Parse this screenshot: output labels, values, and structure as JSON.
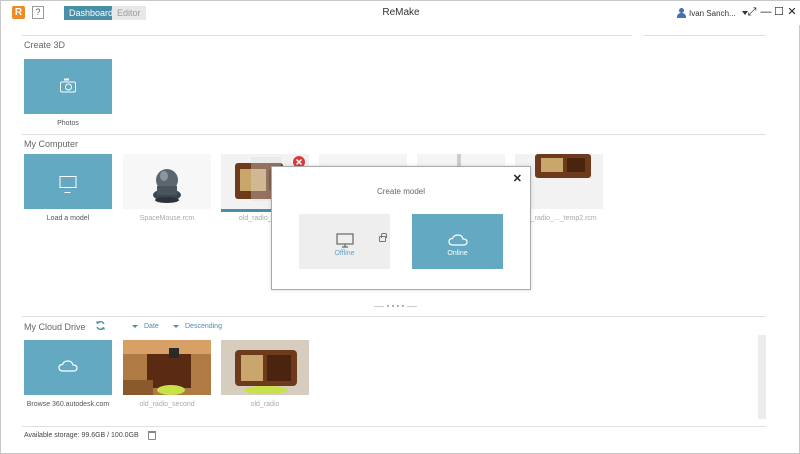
{
  "titlebar": {
    "title": "ReMake",
    "logo_letter": "R",
    "help_label": "?",
    "tabs": [
      {
        "label": "Dashboard",
        "active": true
      },
      {
        "label": "Editor",
        "active": false
      }
    ],
    "user_name": "Ivan Sanch...",
    "controls": {
      "expand": "⤢",
      "minimize": "—",
      "maximize": "☐",
      "close": "✕"
    }
  },
  "create3d": {
    "title": "Create 3D",
    "tiles": [
      {
        "label": "Photos",
        "icon": "camera-icon"
      }
    ]
  },
  "my_computer": {
    "title": "My Computer",
    "load_label": "Load a model",
    "items": [
      {
        "label": "SpaceMouse.rcm"
      },
      {
        "label": "old_radio_..._2..."
      },
      {
        "label": ""
      },
      {
        "label": ""
      },
      {
        "label": "old_radio_..._temp2.rcm"
      }
    ]
  },
  "modal": {
    "title": "Create model",
    "close": "✕",
    "offline_label": "Offline",
    "online_label": "Online"
  },
  "cloud": {
    "title": "My Cloud Drive",
    "sort_field": "Date",
    "sort_order": "Descending",
    "browse_label": "Browse 360.autodesk.com",
    "items": [
      {
        "label": "old_radio_second"
      },
      {
        "label": "old_radio"
      }
    ]
  },
  "footer": {
    "storage": "Available storage: 99.6GB / 100.0GB"
  },
  "colors": {
    "tile": "#64a9c2",
    "accent": "#4a8fa8",
    "logo": "#f08a24"
  }
}
